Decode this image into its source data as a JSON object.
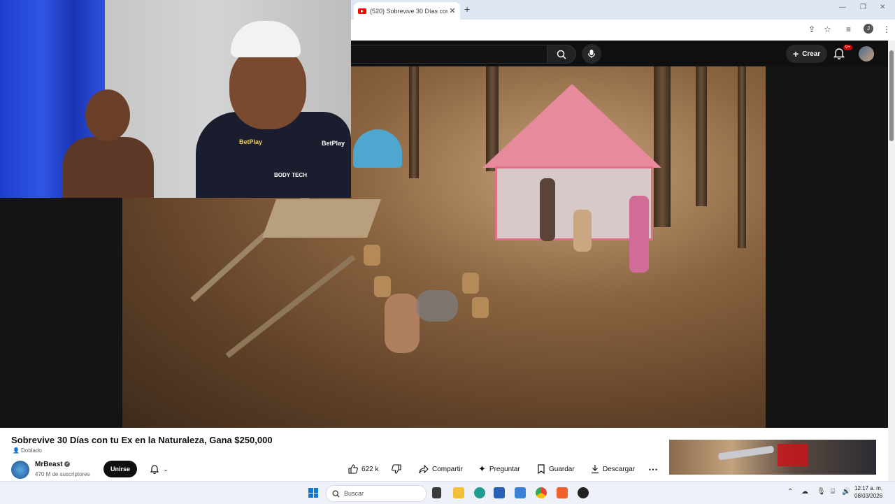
{
  "browser": {
    "tab_title": "(520) Sobrevive 30 Días con tu",
    "tab_close": "✕",
    "new_tab": "+",
    "window_controls": [
      "—",
      "❐",
      "✕"
    ]
  },
  "youtube": {
    "create_label": "Crear",
    "notifications_badge": "9+",
    "video": {
      "title": "Sobrevive 30 Días con tu Ex en la Naturaleza, Gana $250,000",
      "dubbed_label": "Doblado"
    },
    "channel": {
      "name": "MrBeast",
      "subscribers": "470 M de suscriptores",
      "join_label": "Unirse"
    },
    "actions": {
      "likes": "622 k",
      "share": "Compartir",
      "ask": "Preguntar",
      "save": "Guardar",
      "download": "Descargar"
    },
    "webcam_jersey_text": [
      "BetPlay",
      "BODY TECH"
    ]
  },
  "taskbar": {
    "search_placeholder": "Buscar",
    "time": "12:17 a. m.",
    "date": "08/03/2026"
  }
}
